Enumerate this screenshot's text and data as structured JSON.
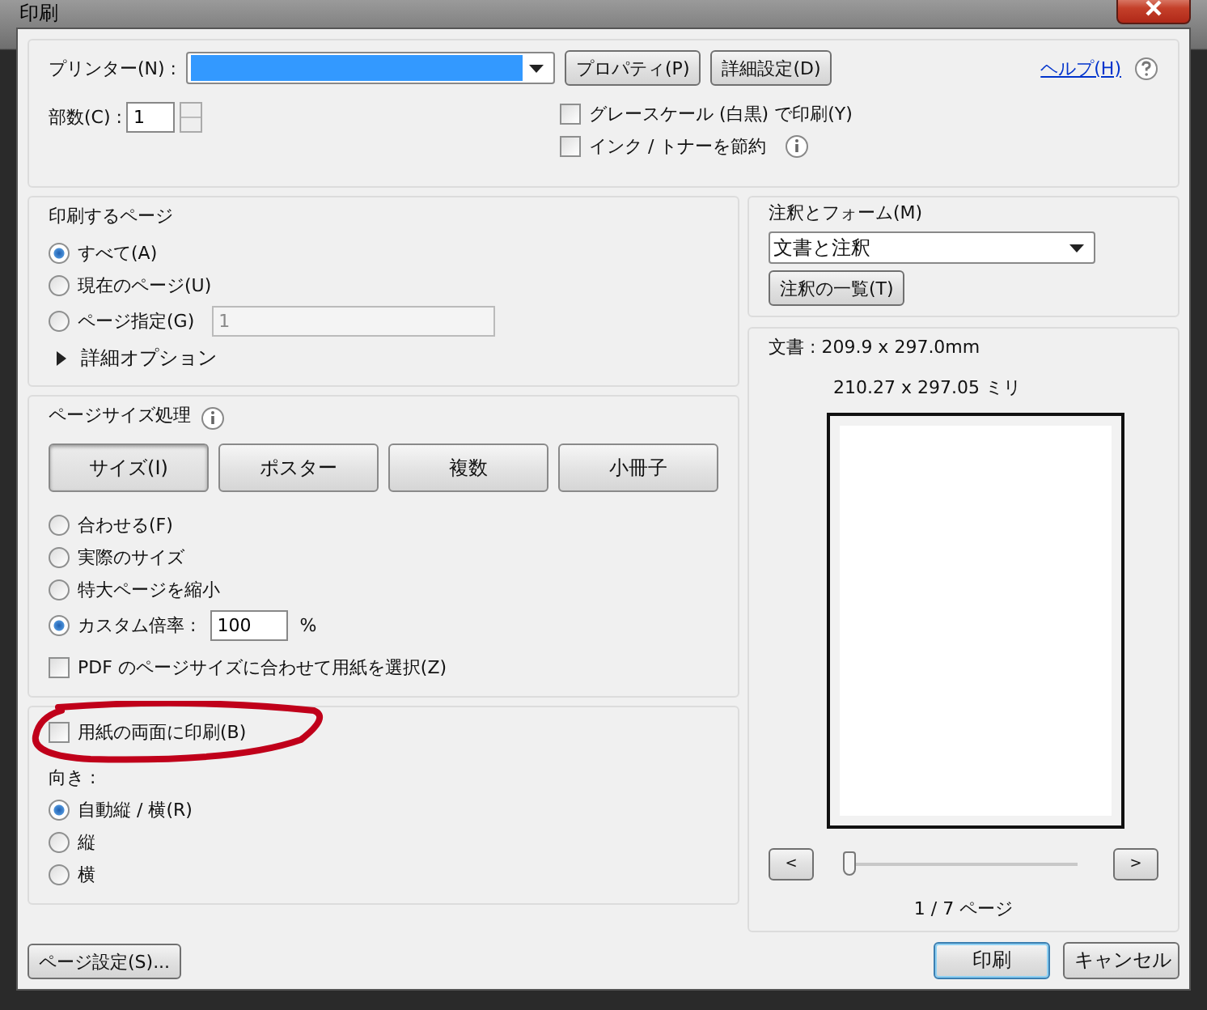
{
  "window": {
    "title": "印刷"
  },
  "printer": {
    "label": "プリンター(N) :",
    "selected": true,
    "buttons": [
      "プロパティ(P)",
      "詳細設定(D)"
    ],
    "help": "ヘルプ(H)"
  },
  "copies": {
    "label": "部数(C) :",
    "value": "1"
  },
  "options": [
    {
      "label": "グレースケール (白黒) で印刷(Y)",
      "checked": false,
      "info": false
    },
    {
      "label": "インク / トナーを節約",
      "checked": false,
      "info": true
    }
  ],
  "pages": {
    "title": "印刷するページ",
    "choices": [
      {
        "label": "すべて(A)",
        "selected": true
      },
      {
        "label": "現在のページ(U)",
        "selected": false
      },
      {
        "label": "ページ指定(G)",
        "selected": false,
        "value": "1"
      }
    ],
    "more": "詳細オプション",
    "expanded": false
  },
  "sizing": {
    "title": "ページサイズ処理",
    "tabs": [
      {
        "label": "サイズ(I)",
        "selected": true
      },
      {
        "label": "ポスター",
        "selected": false
      },
      {
        "label": "複数",
        "selected": false
      },
      {
        "label": "小冊子",
        "selected": false
      }
    ],
    "choices": [
      {
        "label": "合わせる(F)",
        "selected": false
      },
      {
        "label": "実際のサイズ",
        "selected": false
      },
      {
        "label": "特大ページを縮小",
        "selected": false
      },
      {
        "label": "カスタム倍率 :",
        "selected": true,
        "value": "100",
        "unit": "%"
      }
    ],
    "pdf_paper": {
      "label": "PDF のページサイズに合わせて用紙を選択(Z)",
      "checked": false
    }
  },
  "duplex": {
    "label": "用紙の両面に印刷(B)",
    "checked": false,
    "highlighted": true
  },
  "orientation": {
    "title": "向き :",
    "choices": [
      {
        "label": "自動縦 / 横(R)",
        "selected": true
      },
      {
        "label": "縦",
        "selected": false
      },
      {
        "label": "横",
        "selected": false
      }
    ]
  },
  "annotations": {
    "title": "注釈とフォーム(M)",
    "value": "文書と注釈",
    "button": "注釈の一覧(T)"
  },
  "preview": {
    "document": "文書 : 209.9 x 297.0mm",
    "paper": "210.27 x 297.05 ミリ",
    "prev": "<",
    "next": ">",
    "level": 0,
    "page": "1 / 7 ページ"
  },
  "footer": {
    "setup": "ページ設定(S)...",
    "print": "印刷",
    "cancel": "キャンセル"
  }
}
